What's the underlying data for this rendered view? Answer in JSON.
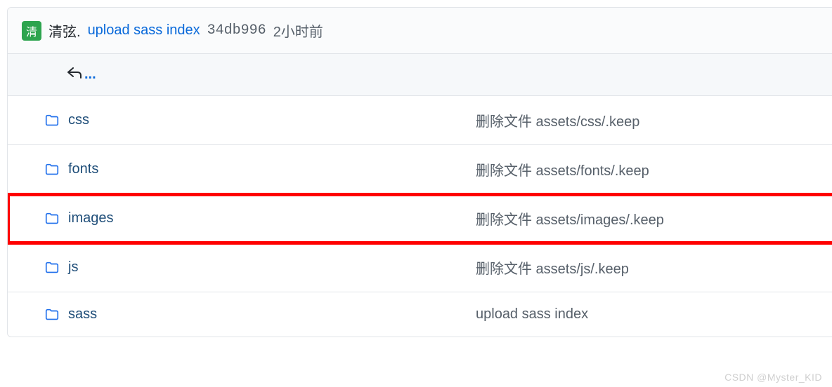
{
  "commit": {
    "avatar_text": "清",
    "author": "清弦.",
    "message": "upload sass index",
    "hash": "34db996",
    "time": "2小时前"
  },
  "nav_up": {
    "dots": "..."
  },
  "files": [
    {
      "name": "css",
      "commit_msg": "删除文件 assets/css/.keep",
      "highlighted": false
    },
    {
      "name": "fonts",
      "commit_msg": "删除文件 assets/fonts/.keep",
      "highlighted": false
    },
    {
      "name": "images",
      "commit_msg": "删除文件 assets/images/.keep",
      "highlighted": true
    },
    {
      "name": "js",
      "commit_msg": "删除文件 assets/js/.keep",
      "highlighted": false
    },
    {
      "name": "sass",
      "commit_msg": "upload sass index",
      "highlighted": false
    }
  ],
  "watermark": "CSDN @Myster_KID"
}
